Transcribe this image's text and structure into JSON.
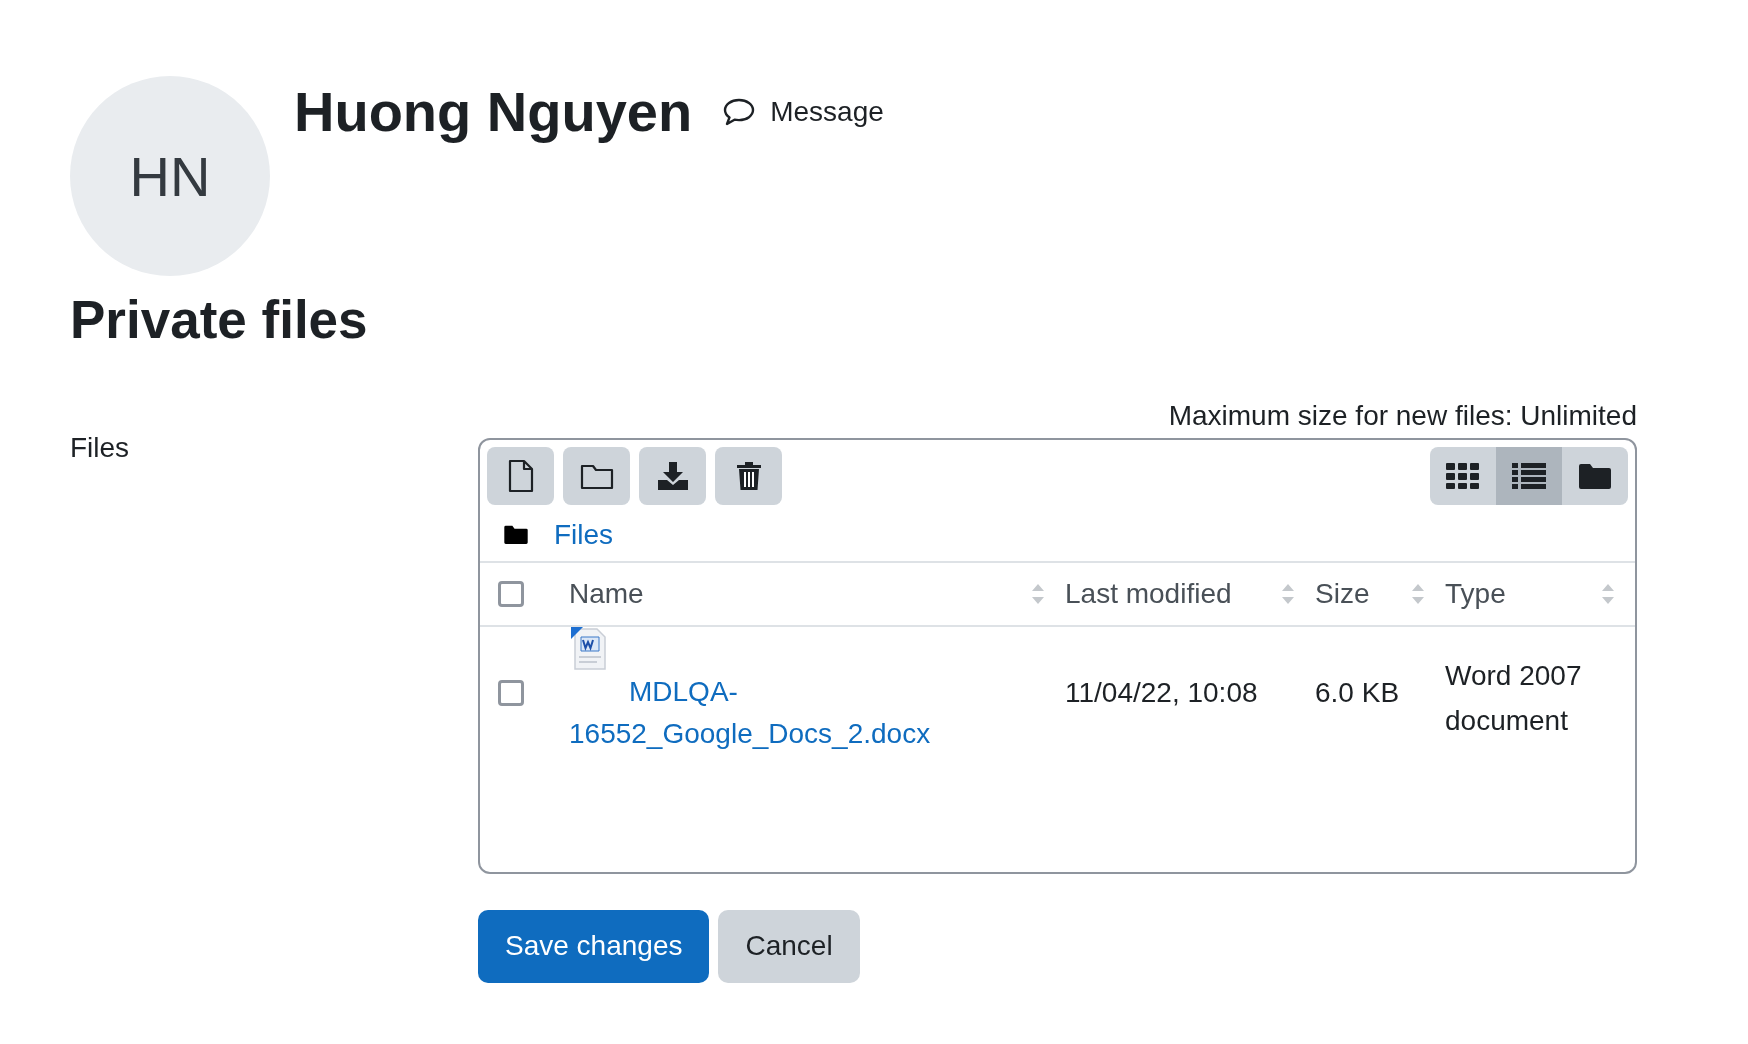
{
  "profile": {
    "initials": "HN",
    "name": "Huong Nguyen",
    "message_link": "Message"
  },
  "page_title": "Private files",
  "form": {
    "label": "Files",
    "max_size": "Maximum size for new files: Unlimited",
    "view_modes": [
      {
        "kind": "icons",
        "selected": false
      },
      {
        "kind": "list",
        "selected": true
      },
      {
        "kind": "tree",
        "selected": false
      }
    ],
    "path": [
      {
        "label": "Files"
      }
    ],
    "select_all_checked": false,
    "columns": [
      {
        "label": "Name"
      },
      {
        "label": "Last modified"
      },
      {
        "label": "Size"
      },
      {
        "label": "Type"
      }
    ],
    "files": [
      {
        "name": "MDLQA-16552_Google_Docs_2.docx",
        "checked": false,
        "last_modified": "11/04/22, 10:08",
        "size": "6.0 KB",
        "type": "Word 2007 document"
      }
    ],
    "buttons": [
      {
        "label": "Save changes",
        "kind": "primary"
      },
      {
        "label": "Cancel",
        "kind": "secondary"
      }
    ]
  }
}
